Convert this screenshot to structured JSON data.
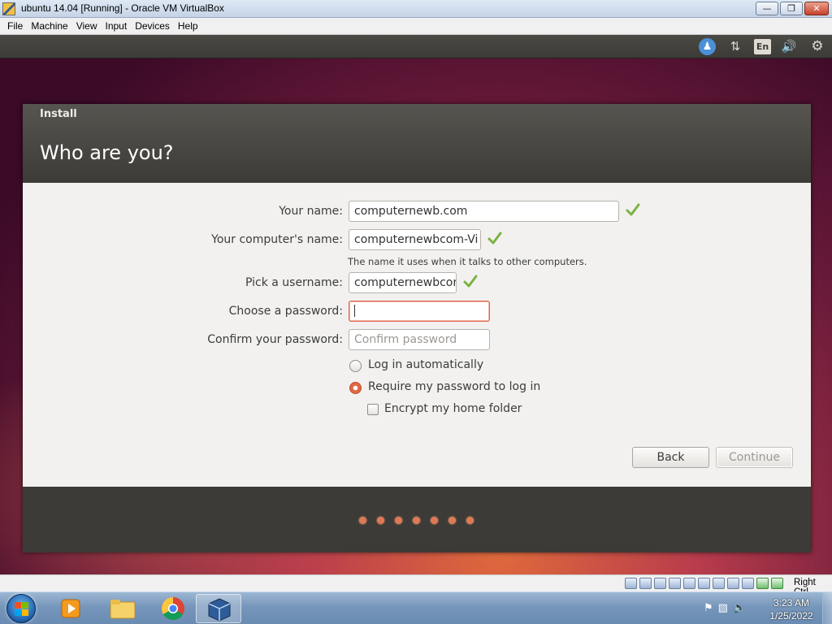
{
  "window": {
    "title": "ubuntu 14.04 [Running] - Oracle VM VirtualBox",
    "minimize_icon": "minimize-icon",
    "restore_icon": "restore-icon",
    "close_icon": "close-icon"
  },
  "menubar": {
    "items": [
      "File",
      "Machine",
      "View",
      "Input",
      "Devices",
      "Help"
    ]
  },
  "ubuntu_panel": {
    "indicators": [
      "accessibility-icon",
      "network-icon",
      "keyboard-layout-indicator",
      "volume-icon",
      "settings-gear-icon"
    ],
    "keyboard_layout": "En"
  },
  "installer": {
    "window_title": "Install",
    "heading": "Who are you?",
    "form": {
      "name_label": "Your name:",
      "name_value": "computernewb.com",
      "computer_name_label": "Your computer's name:",
      "computer_name_value": "computernewbcom-Vi",
      "computer_name_hint": "The name it uses when it talks to other computers.",
      "username_label": "Pick a username:",
      "username_value": "computernewbcom",
      "password_label": "Choose a password:",
      "password_value": "",
      "confirm_label": "Confirm your password:",
      "confirm_placeholder": "Confirm password"
    },
    "login_options": {
      "auto_login_label": "Log in automatically",
      "auto_login_selected": false,
      "require_password_label": "Require my password to log in",
      "require_password_selected": true,
      "encrypt_label": "Encrypt my home folder",
      "encrypt_checked": false
    },
    "buttons": {
      "back": "Back",
      "continue": "Continue"
    },
    "progress": {
      "total_steps": 7
    }
  },
  "vbox_status": {
    "host_key": "Right Ctrl"
  },
  "taskbar": {
    "apps": [
      "media-player-icon",
      "file-explorer-icon",
      "chrome-icon",
      "virtualbox-icon"
    ],
    "clock_time": "3:23 AM",
    "clock_date": "1/25/2022"
  },
  "colors": {
    "ubuntu_orange": "#dd4814",
    "panel_dark": "#3c3b37",
    "body_bg": "#f2f1f0",
    "check_green": "#7cb342"
  }
}
